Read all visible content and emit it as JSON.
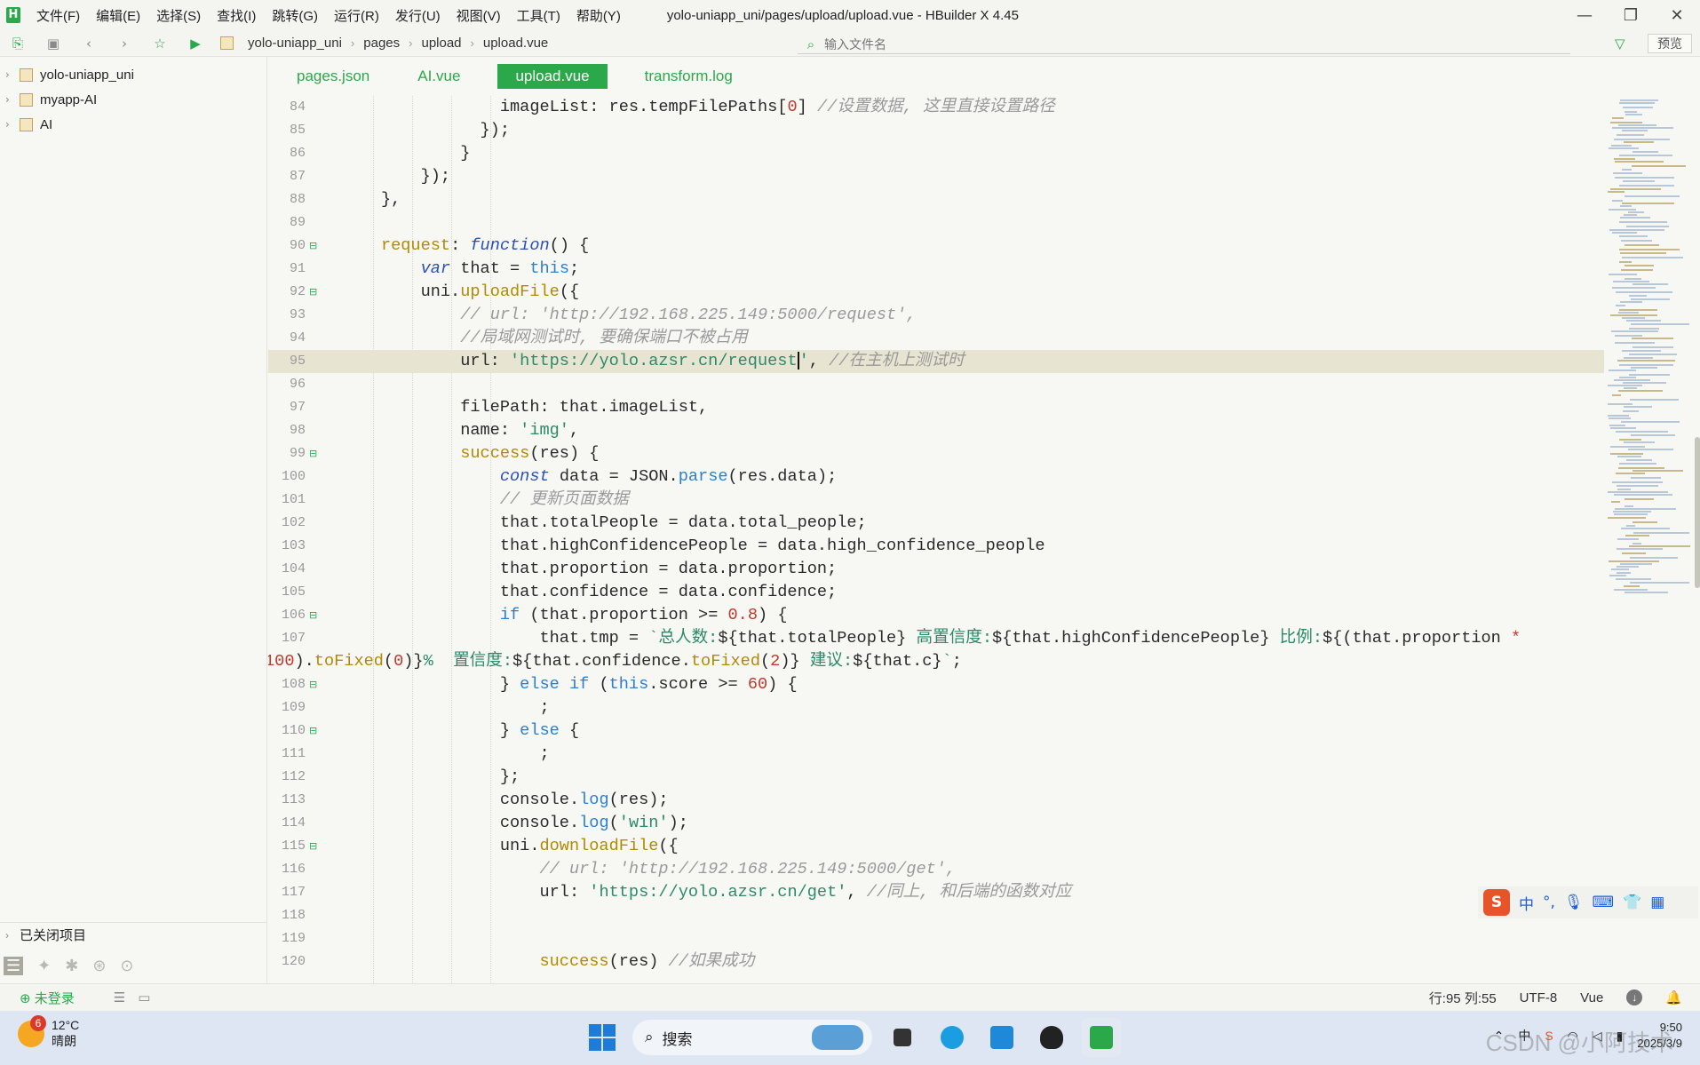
{
  "app": {
    "menu": [
      "文件(F)",
      "编辑(E)",
      "选择(S)",
      "查找(I)",
      "跳转(G)",
      "运行(R)",
      "发行(U)",
      "视图(V)",
      "工具(T)",
      "帮助(Y)"
    ],
    "title": "yolo-uniapp_uni/pages/upload/upload.vue - HBuilder X 4.45",
    "logo": "H"
  },
  "toolbar": {
    "breadcrumb": [
      "yolo-uniapp_uni",
      "pages",
      "upload",
      "upload.vue"
    ],
    "file_search_placeholder": "输入文件名",
    "preview_label": "预览"
  },
  "sidebar": {
    "projects": [
      "yolo-uniapp_uni",
      "myapp-AI",
      "AI"
    ],
    "closed_label": "已关闭项目"
  },
  "tabs": [
    {
      "label": "pages.json",
      "active": false
    },
    {
      "label": "AI.vue",
      "active": false
    },
    {
      "label": "upload.vue",
      "active": true
    },
    {
      "label": "transform.log",
      "active": false
    }
  ],
  "editor": {
    "line_numbers": [
      "84",
      "85",
      "86",
      "87",
      "88",
      "89",
      "90",
      "91",
      "92",
      "93",
      "94",
      "95",
      "96",
      "97",
      "98",
      "99",
      "100",
      "101",
      "102",
      "103",
      "104",
      "105",
      "106",
      "107",
      "",
      "108",
      "109",
      "110",
      "111",
      "112",
      "113",
      "114",
      "115",
      "116",
      "117",
      "118",
      "119",
      "120"
    ],
    "fold_lines": [
      "90",
      "92",
      "99",
      "106",
      "108",
      "110",
      "115"
    ],
    "highlight_line": "95"
  },
  "status": {
    "login": "未登录",
    "position": "行:95  列:55",
    "encoding": "UTF-8",
    "language": "Vue"
  },
  "taskbar": {
    "weather_badge": "6",
    "temp": "12°C",
    "weather": "晴朗",
    "search_label": "搜索",
    "clock_time": "9:50",
    "clock_date": "2025/3/9",
    "tray_lang": "中",
    "watermark": "CSDN @小阿技术"
  },
  "ime": {
    "lang": "中"
  },
  "colors": {
    "accent": "#2aa84a",
    "highlight_line": "#e8e4d2",
    "keyword": "#2a7fcf",
    "string": "#2a8a6a",
    "comment": "#9a9a9a"
  }
}
